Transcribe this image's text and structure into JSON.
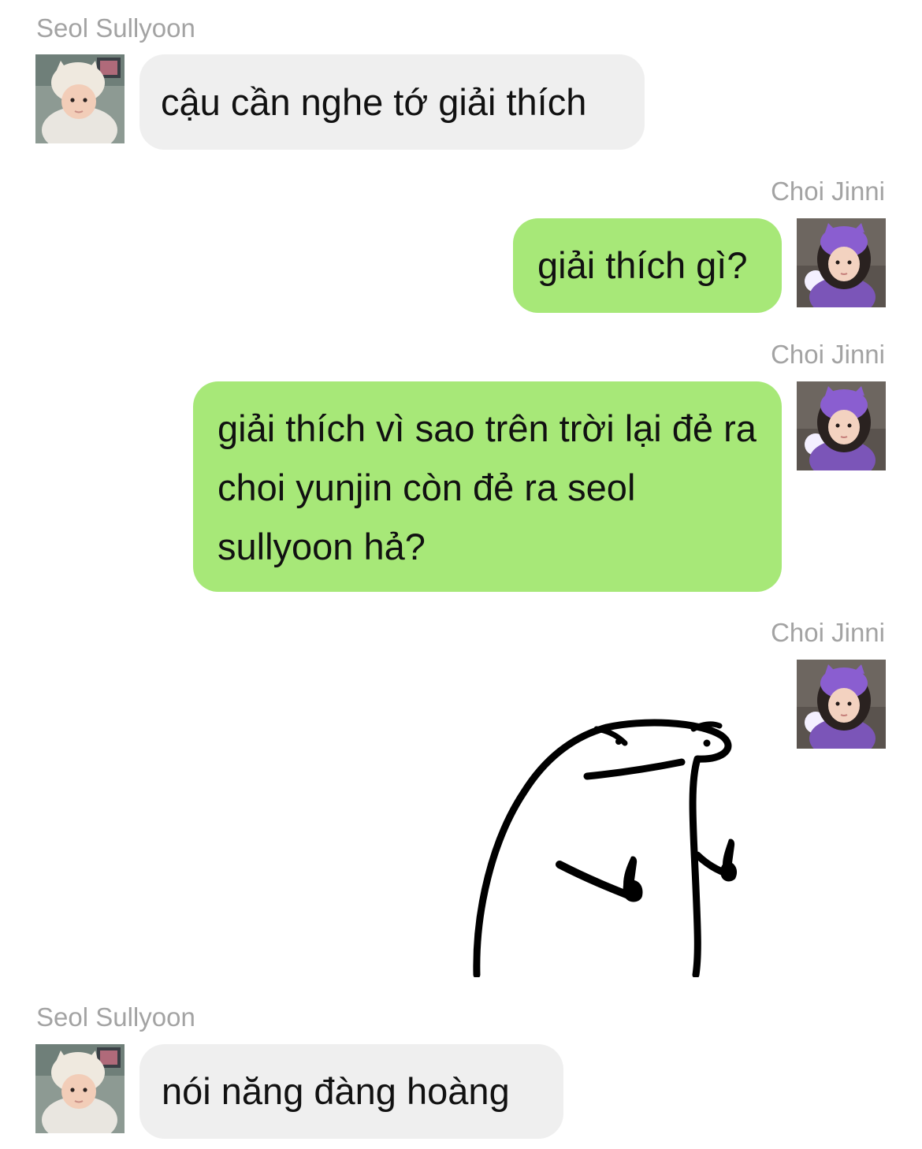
{
  "messages": [
    {
      "sender": "Seol Sullyoon",
      "text": "cậu cần nghe tớ giải thích"
    },
    {
      "sender": "Choi Jinni",
      "text": "giải thích gì?"
    },
    {
      "sender": "Choi Jinni",
      "text": "giải thích vì sao trên trời lại đẻ ra choi yunjin còn đẻ ra seol sullyoon hả?"
    },
    {
      "sender": "Choi Jinni",
      "sticker": "middle-finger-blob-sticker"
    },
    {
      "sender": "Seol Sullyoon",
      "text": "nói năng đàng hoàng"
    }
  ],
  "colors": {
    "incoming_bubble": "#efefef",
    "outgoing_bubble": "#a7e878",
    "sender_name": "#a3a3a3"
  }
}
